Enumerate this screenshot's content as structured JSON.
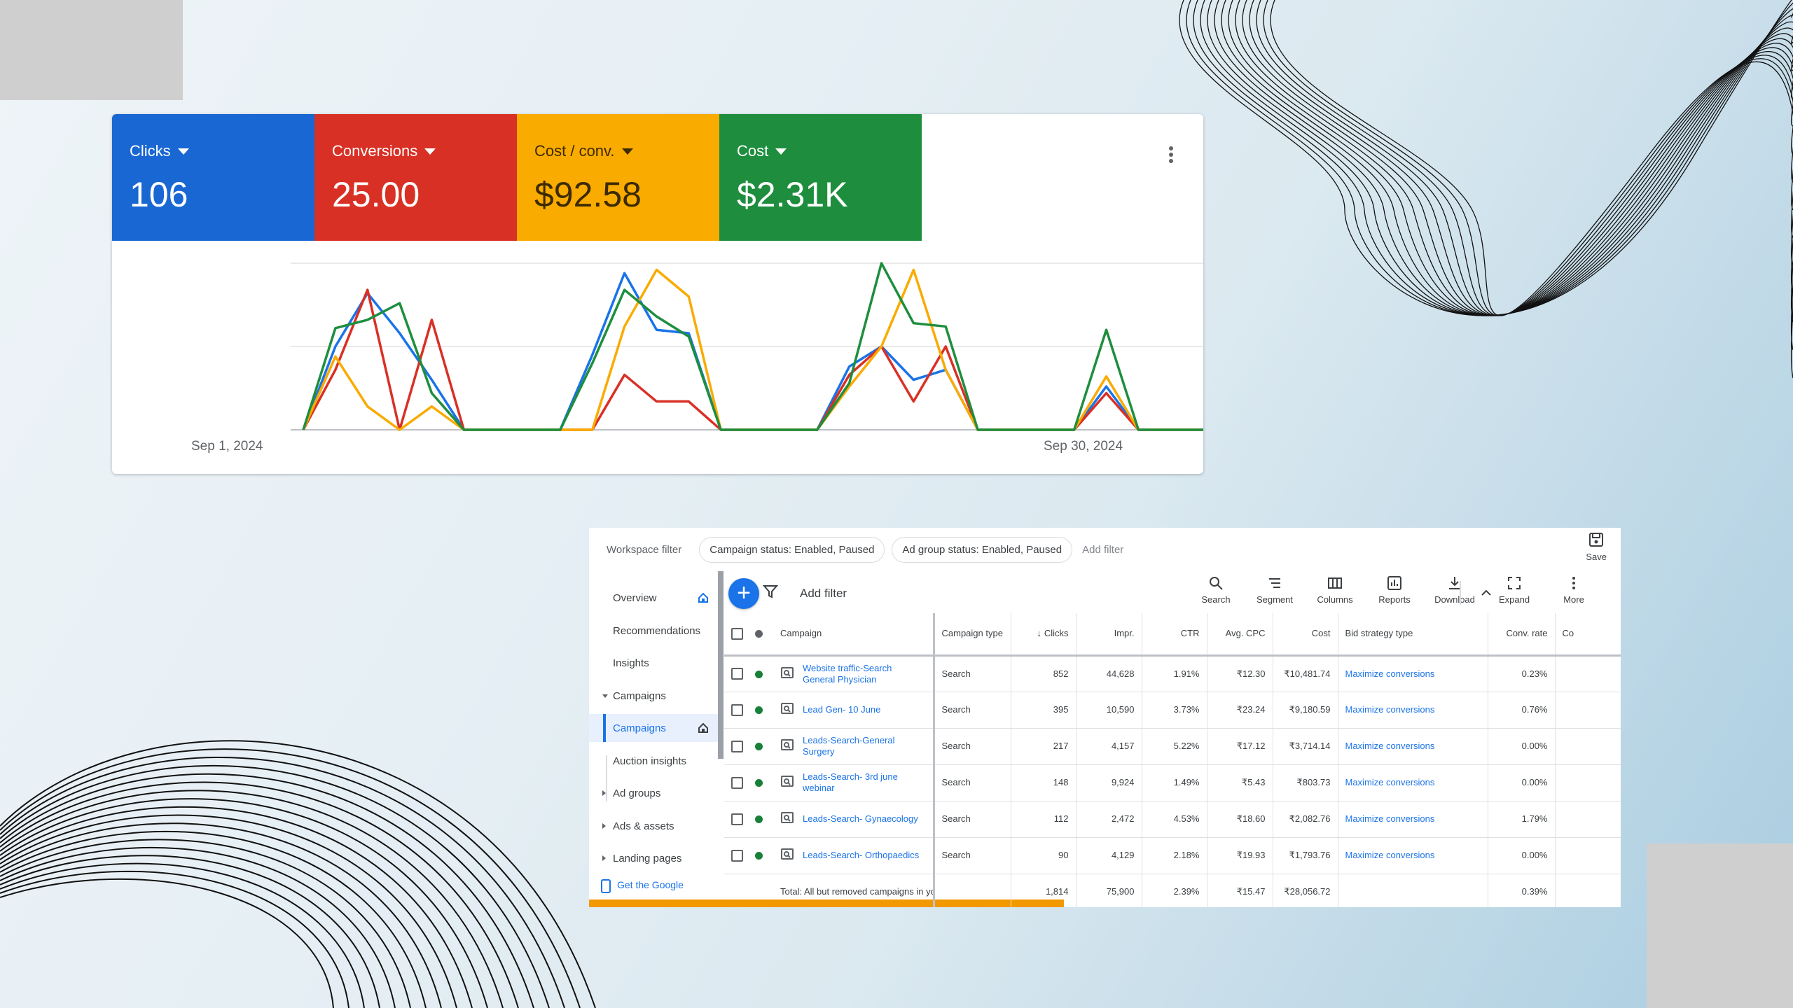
{
  "chart_card": {
    "tiles": [
      {
        "label": "Clicks",
        "value": "106",
        "color": "#1967d2"
      },
      {
        "label": "Conversions",
        "value": "25.00",
        "color": "#d93025"
      },
      {
        "label": "Cost / conv.",
        "value": "$92.58",
        "color": "#f9ab00"
      },
      {
        "label": "Cost",
        "value": "$2.31K",
        "color": "#1e8e3e"
      }
    ],
    "more_icon": "kebab-vertical-icon"
  },
  "chart_data": {
    "type": "line",
    "x_start_label": "Sep 1, 2024",
    "x_end_label": "Sep 30, 2024",
    "x": [
      1,
      2,
      3,
      4,
      5,
      6,
      7,
      8,
      9,
      10,
      11,
      12,
      13,
      14,
      15,
      16,
      17,
      18,
      19,
      20,
      21,
      22,
      23,
      24,
      25,
      26,
      27,
      28,
      29,
      30
    ],
    "ylim": [
      0,
      100
    ],
    "grid": true,
    "series": [
      {
        "name": "Clicks",
        "color": "#1a73e8",
        "values": [
          0,
          50,
          82,
          58,
          30,
          0,
          0,
          0,
          0,
          45,
          94,
          60,
          58,
          0,
          0,
          0,
          0,
          38,
          50,
          30,
          36,
          0,
          0,
          0,
          0,
          26,
          0,
          0,
          0,
          0
        ]
      },
      {
        "name": "Conversions",
        "color": "#d93025",
        "values": [
          0,
          36,
          84,
          0,
          66,
          0,
          0,
          0,
          0,
          0,
          33,
          17,
          17,
          0,
          0,
          0,
          0,
          33,
          50,
          17,
          50,
          0,
          0,
          0,
          0,
          22,
          0,
          0,
          0,
          0
        ]
      },
      {
        "name": "Cost / conv.",
        "color": "#f9ab00",
        "values": [
          0,
          44,
          14,
          0,
          14,
          0,
          0,
          0,
          0,
          0,
          62,
          96,
          80,
          0,
          0,
          0,
          0,
          26,
          50,
          96,
          36,
          0,
          0,
          0,
          0,
          32,
          0,
          0,
          0,
          0
        ]
      },
      {
        "name": "Cost",
        "color": "#1e8e3e",
        "values": [
          0,
          61,
          66,
          76,
          22,
          0,
          0,
          0,
          0,
          40,
          84,
          68,
          56,
          0,
          0,
          0,
          0,
          28,
          100,
          64,
          62,
          0,
          0,
          0,
          0,
          60,
          0,
          0,
          0,
          0
        ]
      }
    ]
  },
  "ads": {
    "workspace_filter_label": "Workspace filter",
    "chips": [
      "Campaign status: Enabled, Paused",
      "Ad group status: Enabled, Paused"
    ],
    "add_filter_top": "Add filter",
    "save_label": "Save",
    "nav": {
      "overview": "Overview",
      "recommendations": "Recommendations",
      "insights": "Insights",
      "campaigns_group": "Campaigns",
      "campaigns": "Campaigns",
      "auction_insights": "Auction insights",
      "ad_groups": "Ad groups",
      "ads_assets": "Ads & assets",
      "landing_pages": "Landing pages",
      "get_app": "Get the Google"
    },
    "toolbar": {
      "add_filter": "Add filter",
      "search": "Search",
      "segment": "Segment",
      "columns": "Columns",
      "reports": "Reports",
      "download": "Download",
      "expand": "Expand",
      "more": "More"
    },
    "columns": {
      "campaign": "Campaign",
      "campaign_type": "Campaign type",
      "clicks": "Clicks",
      "impr": "Impr.",
      "ctr": "CTR",
      "avg_cpc": "Avg. CPC",
      "cost": "Cost",
      "bid_strategy": "Bid strategy type",
      "conv_rate": "Conv. rate",
      "cut": "Co"
    },
    "rows": [
      {
        "campaign": "Website traffic-Search General Physician",
        "type": "Search",
        "clicks": "852",
        "impr": "44,628",
        "ctr": "1.91%",
        "cpc": "₹12.30",
        "cost": "₹10,481.74",
        "bid": "Maximize conversions",
        "conv_rate": "0.23%"
      },
      {
        "campaign": "Lead Gen- 10 June",
        "type": "Search",
        "clicks": "395",
        "impr": "10,590",
        "ctr": "3.73%",
        "cpc": "₹23.24",
        "cost": "₹9,180.59",
        "bid": "Maximize conversions",
        "conv_rate": "0.76%"
      },
      {
        "campaign": "Leads-Search-General Surgery",
        "type": "Search",
        "clicks": "217",
        "impr": "4,157",
        "ctr": "5.22%",
        "cpc": "₹17.12",
        "cost": "₹3,714.14",
        "bid": "Maximize conversions",
        "conv_rate": "0.00%"
      },
      {
        "campaign": "Leads-Search- 3rd june webinar",
        "type": "Search",
        "clicks": "148",
        "impr": "9,924",
        "ctr": "1.49%",
        "cpc": "₹5.43",
        "cost": "₹803.73",
        "bid": "Maximize conversions",
        "conv_rate": "0.00%"
      },
      {
        "campaign": "Leads-Search- Gynaecology",
        "type": "Search",
        "clicks": "112",
        "impr": "2,472",
        "ctr": "4.53%",
        "cpc": "₹18.60",
        "cost": "₹2,082.76",
        "bid": "Maximize conversions",
        "conv_rate": "1.79%"
      },
      {
        "campaign": "Leads-Search- Orthopaedics",
        "type": "Search",
        "clicks": "90",
        "impr": "4,129",
        "ctr": "2.18%",
        "cpc": "₹19.93",
        "cost": "₹1,793.76",
        "bid": "Maximize conversions",
        "conv_rate": "0.00%"
      }
    ],
    "total": {
      "label": "Total: All but removed campaigns in your",
      "clicks": "1,814",
      "impr": "75,900",
      "ctr": "2.39%",
      "cpc": "₹15.47",
      "cost": "₹28,056.72",
      "conv_rate": "0.39%"
    }
  }
}
